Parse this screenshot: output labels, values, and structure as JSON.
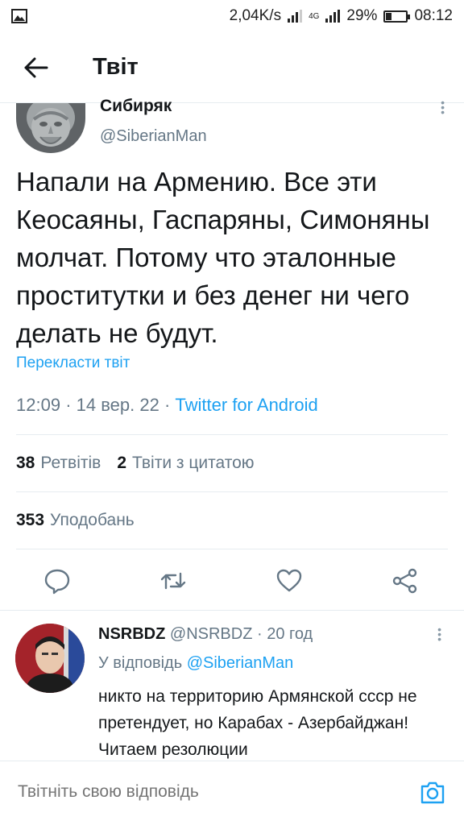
{
  "status_bar": {
    "speed": "2,04K/s",
    "battery": "29%",
    "battery_level": 0.29,
    "time": "08:12",
    "network": "4G"
  },
  "header": {
    "title": "Твіт"
  },
  "tweet": {
    "author_name": "Сибиряк",
    "author_handle": "@SiberianMan",
    "text": "Напали на Армению. Все эти Кеосаяны, Гаспаряны, Симоняны молчат. Потому что эталонные проститутки и без денег ни чего делать не будут.",
    "translate_label": "Перекласти твіт",
    "time": "12:09",
    "date": "14 вер. 22",
    "source": "Twitter for Android",
    "retweets_count": "38",
    "retweets_label": "Ретвітів",
    "quotes_count": "2",
    "quotes_label": "Твіти з цитатою",
    "likes_count": "353",
    "likes_label": "Уподобань"
  },
  "reply": {
    "name": "NSRBDZ",
    "handle": "@NSRBDZ",
    "age": "20 год",
    "reply_to_label": "У відповідь",
    "reply_to_handle": "@SiberianMan",
    "text": "никто на территорию Армянской ссср не претендует, но Карабах - Азербайджан! Читаем резолюции"
  },
  "compose": {
    "placeholder": "Твітніть свою відповідь"
  },
  "icons": {
    "back": "arrow-left-icon",
    "reply": "comment-icon",
    "retweet": "retweet-icon",
    "like": "heart-icon",
    "share": "share-icon",
    "camera": "camera-icon",
    "more": "more-vertical-icon"
  },
  "colors": {
    "accent": "#1da1f2",
    "secondary_text": "#657786",
    "icon": "#657786"
  }
}
